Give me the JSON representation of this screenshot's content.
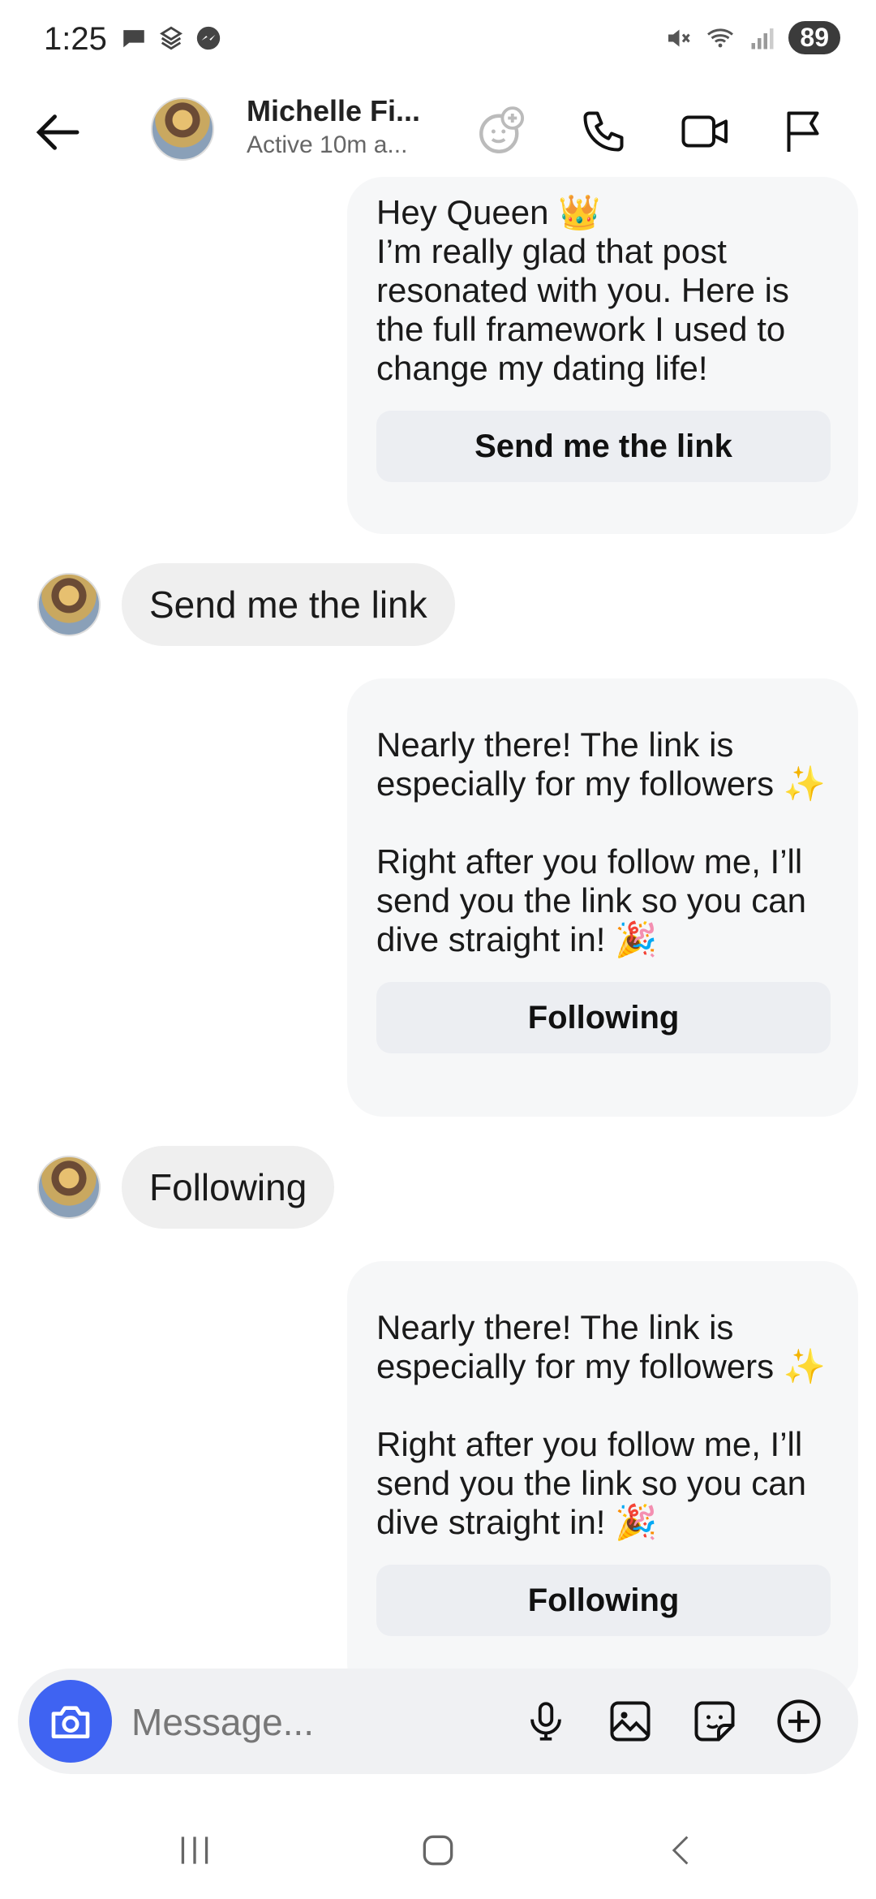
{
  "status_bar": {
    "time": "1:25",
    "battery": "89"
  },
  "header": {
    "name": "Michelle Fi...",
    "status": "Active 10m a..."
  },
  "messages": {
    "m1": {
      "text": "Hey Queen 👑\nI’m really glad that post resonated with you. Here is the full framework I used to change my dating life!",
      "button": "Send me the link"
    },
    "r1": {
      "text": "Send me the link"
    },
    "m2": {
      "text": "Nearly there! The link is especially for my followers ✨\n\nRight after you follow me, I’ll send you the link so you can dive straight in! 🎉",
      "button": "Following"
    },
    "r2": {
      "text": "Following"
    },
    "m3": {
      "text": "Nearly there! The link is especially for my followers ✨\n\nRight after you follow me, I’ll send you the link so you can dive straight in! 🎉",
      "button": "Following"
    }
  },
  "composer": {
    "placeholder": "Message..."
  },
  "colors": {
    "accent": "#3f63f2",
    "bubble_out": "#f6f7f8",
    "bubble_in": "#efefef"
  }
}
